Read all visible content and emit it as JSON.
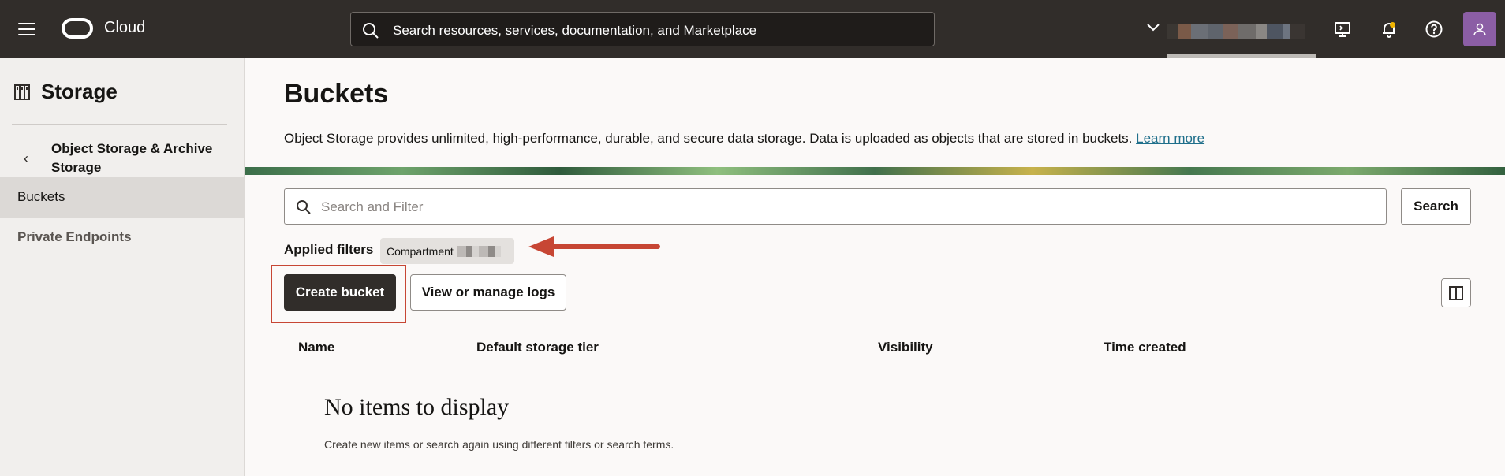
{
  "header": {
    "brand": "Cloud",
    "search_placeholder": "Search resources, services, documentation, and Marketplace",
    "accent_avatar": "#8b5ea5"
  },
  "sidebar": {
    "title": "Storage",
    "parent": "Object Storage & Archive Storage",
    "items": [
      {
        "label": "Buckets",
        "active": true
      },
      {
        "label": "Private Endpoints",
        "active": false
      }
    ]
  },
  "main": {
    "title": "Buckets",
    "description": "Object Storage provides unlimited, high-performance, durable, and secure data storage. Data is uploaded as objects that are stored in buckets.",
    "learn_more": "Learn more",
    "filter_placeholder": "Search and Filter",
    "search_button": "Search",
    "applied_filters_label": "Applied filters",
    "chip_label": "Compartment",
    "create_button": "Create bucket",
    "logs_button": "View or manage logs",
    "columns": [
      "Name",
      "Default storage tier",
      "Visibility",
      "Time created"
    ],
    "empty_title": "No items to display",
    "empty_subtitle": "Create new items or search again using different filters or search terms."
  },
  "annotation": {
    "color": "#c74634"
  }
}
